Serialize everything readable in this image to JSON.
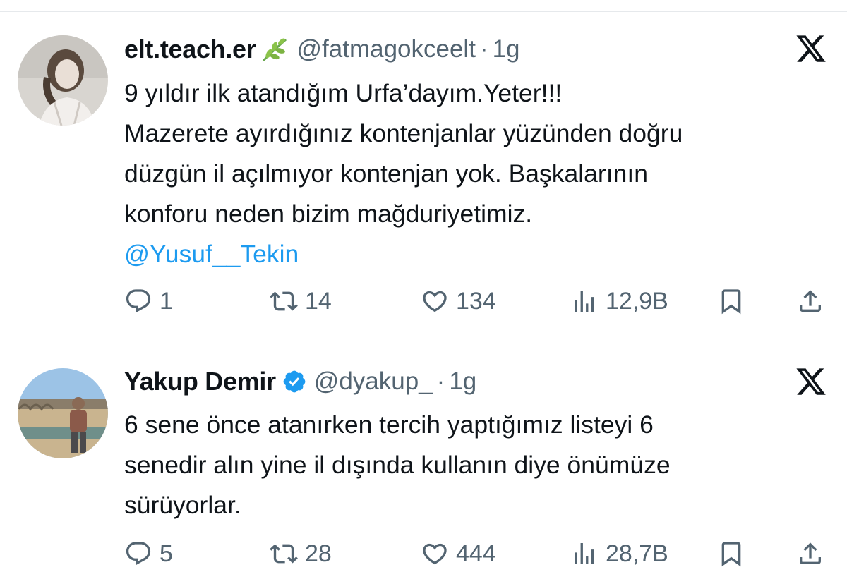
{
  "tweets": [
    {
      "display_name": "elt.teach.er",
      "name_emoji": "herb-icon",
      "verified": false,
      "handle": "@fatmagokceelt",
      "separator": "·",
      "time": "1g",
      "text_lines": [
        "9 yıldır ilk atandığım Urfa’dayım.Yeter!!!",
        "Mazerete ayırdığınız kontenjanlar yüzünden doğru",
        "düzgün il açılmıyor kontenjan yok. Başkalarının",
        "konforu neden bizim mağduriyetimiz."
      ],
      "mention": "@Yusuf__Tekin",
      "stats": {
        "replies": "1",
        "retweets": "14",
        "likes": "134",
        "views": "12,9B"
      }
    },
    {
      "display_name": "Yakup Demir",
      "verified": true,
      "handle": "@dyakup_",
      "separator": "·",
      "time": "1g",
      "text_lines": [
        "6 sene önce atanırken tercih yaptığımız listeyi 6",
        "senedir alın yine il dışında kullanın diye önümüze",
        "sürüyorlar."
      ],
      "stats": {
        "replies": "5",
        "retweets": "28",
        "likes": "444",
        "views": "28,7B"
      }
    }
  ],
  "colors": {
    "text": "#0f1419",
    "secondary": "#536471",
    "link": "#1d9bf0",
    "verified": "#1d9bf0",
    "divider": "#e6e9ec"
  }
}
